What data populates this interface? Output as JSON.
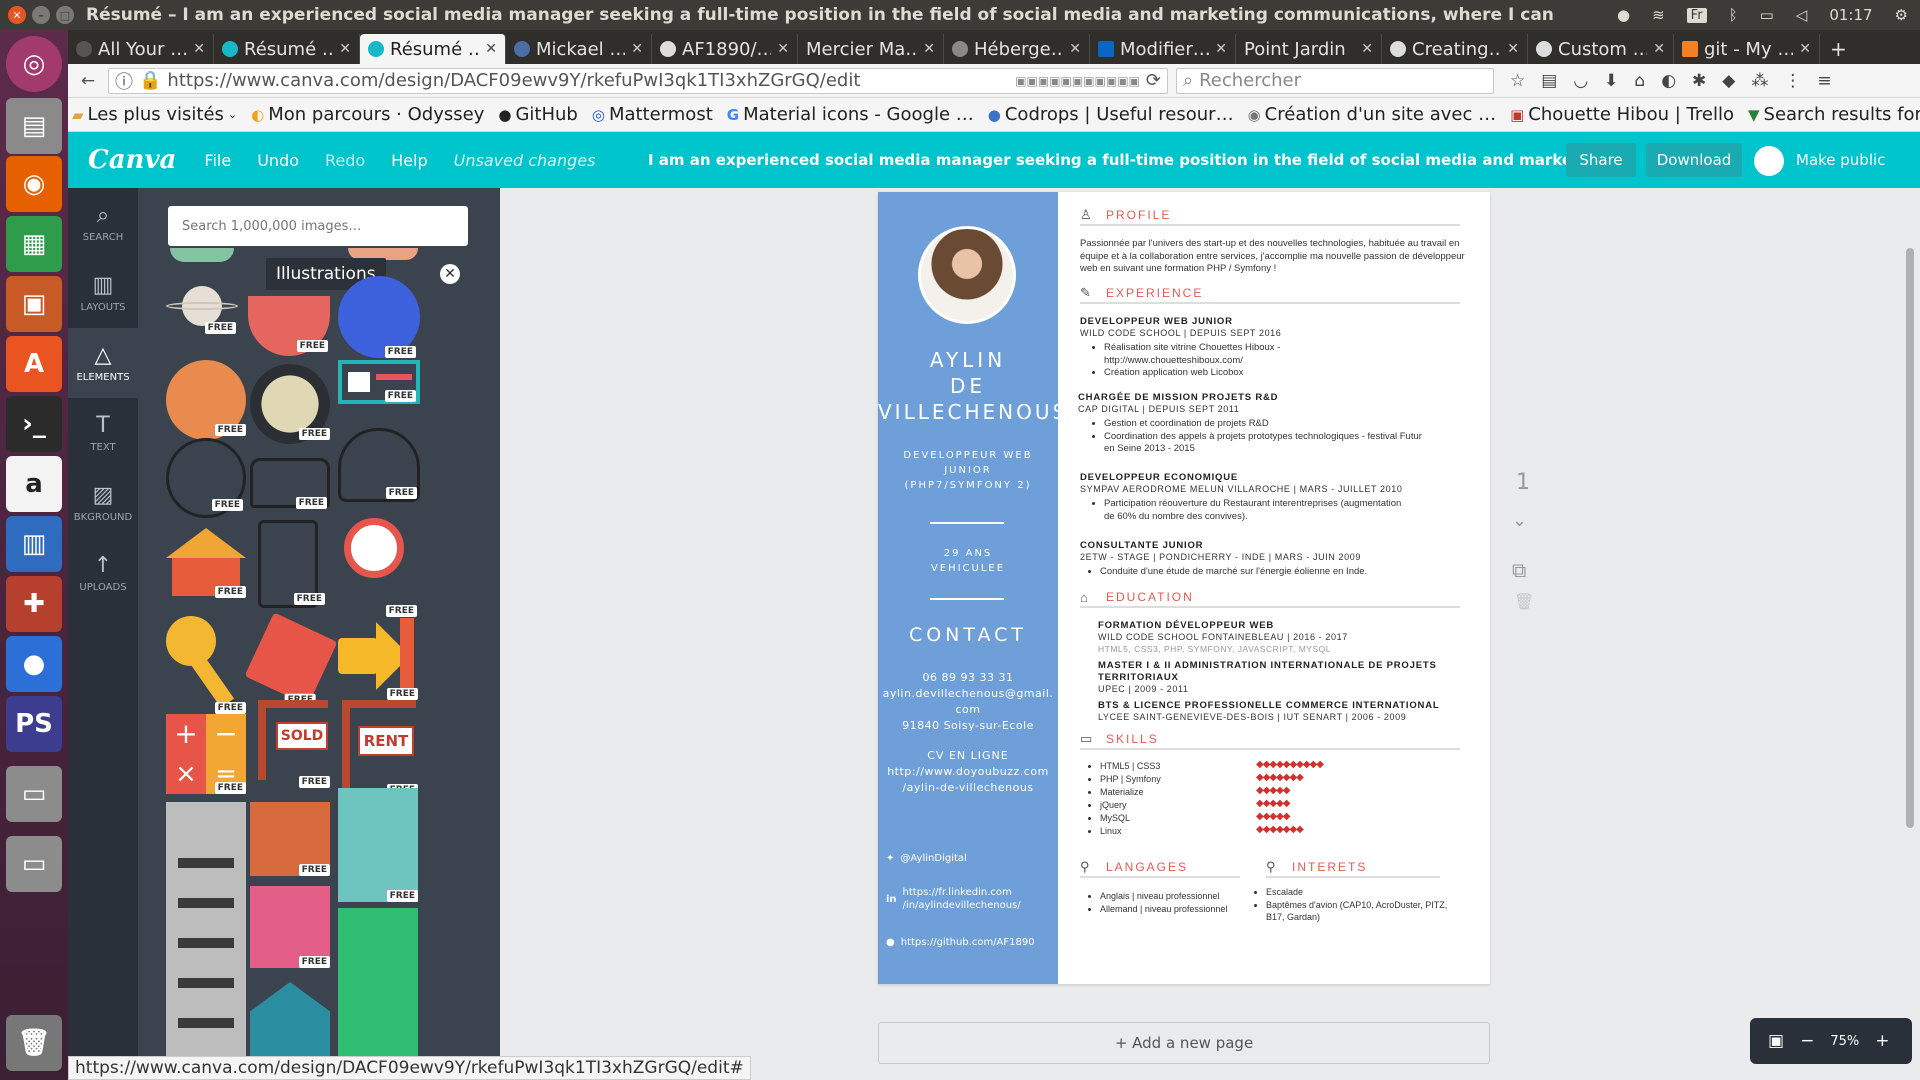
{
  "os": {
    "window_title": "Résumé – I am an experienced social media manager seeking a full-time position in the field of social media and marketing communications, where I can apply my kn",
    "time": "01:17",
    "keyboard": "Fr"
  },
  "tabs": [
    {
      "label": "All Your …"
    },
    {
      "label": "Résumé …"
    },
    {
      "label": "Résumé …"
    },
    {
      "label": "Mickael …"
    },
    {
      "label": "AF1890/…"
    },
    {
      "label": "Mercier Ma…"
    },
    {
      "label": "Héberge…"
    },
    {
      "label": "Modifier…"
    },
    {
      "label": "Point Jardin"
    },
    {
      "label": "Creating…"
    },
    {
      "label": "Custom …"
    },
    {
      "label": "git - My …"
    }
  ],
  "nav": {
    "url": "https://www.canva.com/design/DACF09ewv9Y/rkefuPwI3qk1TI3xhZGrGQ/edit",
    "search_placeholder": "Rechercher"
  },
  "bookmarks": [
    {
      "label": "Les plus visités",
      "icon": "folder-icon"
    },
    {
      "label": "Mon parcours · Odyssey",
      "icon": "odyssey-icon"
    },
    {
      "label": "GitHub",
      "icon": "github-icon"
    },
    {
      "label": "Mattermost",
      "icon": "mattermost-icon"
    },
    {
      "label": "Material icons - Google …",
      "icon": "google-icon"
    },
    {
      "label": "Codrops | Useful resour…",
      "icon": "codrops-icon"
    },
    {
      "label": "Création d'un site avec …",
      "icon": "site-icon"
    },
    {
      "label": "Chouette Hibou | Trello",
      "icon": "trello-icon"
    },
    {
      "label": "Search results for Social…",
      "icon": "filter-icon"
    }
  ],
  "canva": {
    "logo": "Canva",
    "menu": {
      "file": "File",
      "undo": "Undo",
      "redo": "Redo",
      "help": "Help"
    },
    "unsaved": "Unsaved changes",
    "design_title": "I am an experienced social media manager seeking a full-time position in the field of social media and marketing communication…",
    "share": "Share",
    "download": "Download",
    "make_public": "Make public"
  },
  "rail": {
    "search": "SEARCH",
    "layouts": "LAYOUTS",
    "elements": "ELEMENTS",
    "text": "TEXT",
    "background": "BKGROUND",
    "uploads": "UPLOADS"
  },
  "panel": {
    "search_placeholder": "Search 1,000,000 images…",
    "tooltip": "Illustrations",
    "free": "FREE",
    "sign_sold": "SOLD",
    "sign_rent": "RENT"
  },
  "resume": {
    "name1": "AYLIN",
    "name2": "DE",
    "name3": "VILLECHENOUS",
    "role1": "DEVELOPPEUR WEB",
    "role2": "JUNIOR",
    "role3": "(PHP7/SYMFONY 2)",
    "age": "29 ANS",
    "vehicle": "VEHICULEE",
    "contact_title": "CONTACT",
    "phone": "06 89 93 33 31",
    "email1": "aylin.devillechenous@gmail.",
    "email2": "com",
    "city": "91840 Soisy-sur-Ecole",
    "cv_title": "CV EN LIGNE",
    "cv1": "http://www.doyoubuzz.com",
    "cv2": "/aylin-de-villechenous",
    "twitter": "@AylinDigital",
    "linkedin1": "https://fr.linkedin.com",
    "linkedin2": "/in/aylindevillechenous/",
    "github": "https://github.com/AF1890",
    "profile_title": "PROFILE",
    "profile_text": "Passionnée par l'univers des start-up et des nouvelles technologies, habituée au travail en équipe et à la collaboration entre services, j'accomplie ma nouvelle passion de développeur web en suivant une formation PHP / Symfony !",
    "experience_title": "EXPERIENCE",
    "jobs": [
      {
        "title": "DEVELOPPEUR WEB JUNIOR",
        "sub": "WILD CODE SCHOOL  |  DEPUIS SEPT 2016",
        "items": [
          "Réalisation site vitrine Chouettes Hiboux - http://www.chouetteshiboux.com/",
          "Création application web Licobox"
        ]
      },
      {
        "title": "CHARGÉE DE MISSION PROJETS R&D",
        "sub": "CAP DIGITAL  |  DEPUIS SEPT 2011",
        "items": [
          "Gestion et coordination de projets R&D",
          "Coordination des appels à projets prototypes technologiques - festival Futur en Seine 2013 - 2015"
        ]
      },
      {
        "title": "DEVELOPPEUR ECONOMIQUE",
        "sub": "SYMPAV AERODROME MELUN VILLAROCHE | MARS - JUILLET 2010",
        "items": [
          "Participation réouverture du Restaurant interentreprises (augmentation de 60% du nombre des convives)."
        ]
      },
      {
        "title": "CONSULTANTE JUNIOR",
        "sub": "2ETW - STAGE | PONDICHERRY - INDE | MARS - JUIN 2009",
        "items": [
          "Conduite d'une étude de marché sur l'énergie éolienne en Inde."
        ]
      }
    ],
    "education_title": "EDUCATION",
    "education": [
      {
        "title": "FORMATION DÉVELOPPEUR WEB",
        "sub": "WILD CODE SCHOOL FONTAINEBLEAU  |  2016 - 2017",
        "hint": "HTML5, CSS3, PHP, SYMFONY, JAVASCRIPT,  MYSQL"
      },
      {
        "title": "MASTER I & II ADMINISTRATION INTERNATIONALE DE PROJETS",
        "title2": "TERRITORIAUX",
        "sub": "UPEC  |  2009 - 2011"
      },
      {
        "title": "BTS & LICENCE PROFESSIONELLE  COMMERCE INTERNATIONAL",
        "sub": "LYCEE SAINT-GENEVIEVE-DES-BOIS | IUT SENART  |  2006 - 2009"
      }
    ],
    "skills_title": "SKILLS",
    "skills": [
      {
        "name": "HTML5 | CSS3",
        "dots": "◆◆◆◆◆◆◆◆◆◆"
      },
      {
        "name": "PHP | Symfony",
        "dots": "◆◆◆◆◆◆◆"
      },
      {
        "name": "Materialize",
        "dots": "◆◆◆◆◆"
      },
      {
        "name": "jQuery",
        "dots": "◆◆◆◆◆"
      },
      {
        "name": "MySQL",
        "dots": "◆◆◆◆◆"
      },
      {
        "name": "Linux",
        "dots": "◆◆◆◆◆◆◆"
      }
    ],
    "languages_title": "LANGAGES",
    "languages": [
      "Anglais | niveau professionnel",
      "Allemand | niveau professionnel"
    ],
    "interests_title": "INTERETS",
    "interests": [
      "Escalade",
      "Baptêmes d'avion (CAP10, AcroDuster, PITZ, B17, Gardan)"
    ]
  },
  "workspace": {
    "page_number": "1",
    "add_page": "+ Add a new page",
    "zoom": "75%"
  },
  "status_url": "https://www.canva.com/design/DACF09ewv9Y/rkefuPwI3qk1TI3xhZGrGQ/edit#"
}
